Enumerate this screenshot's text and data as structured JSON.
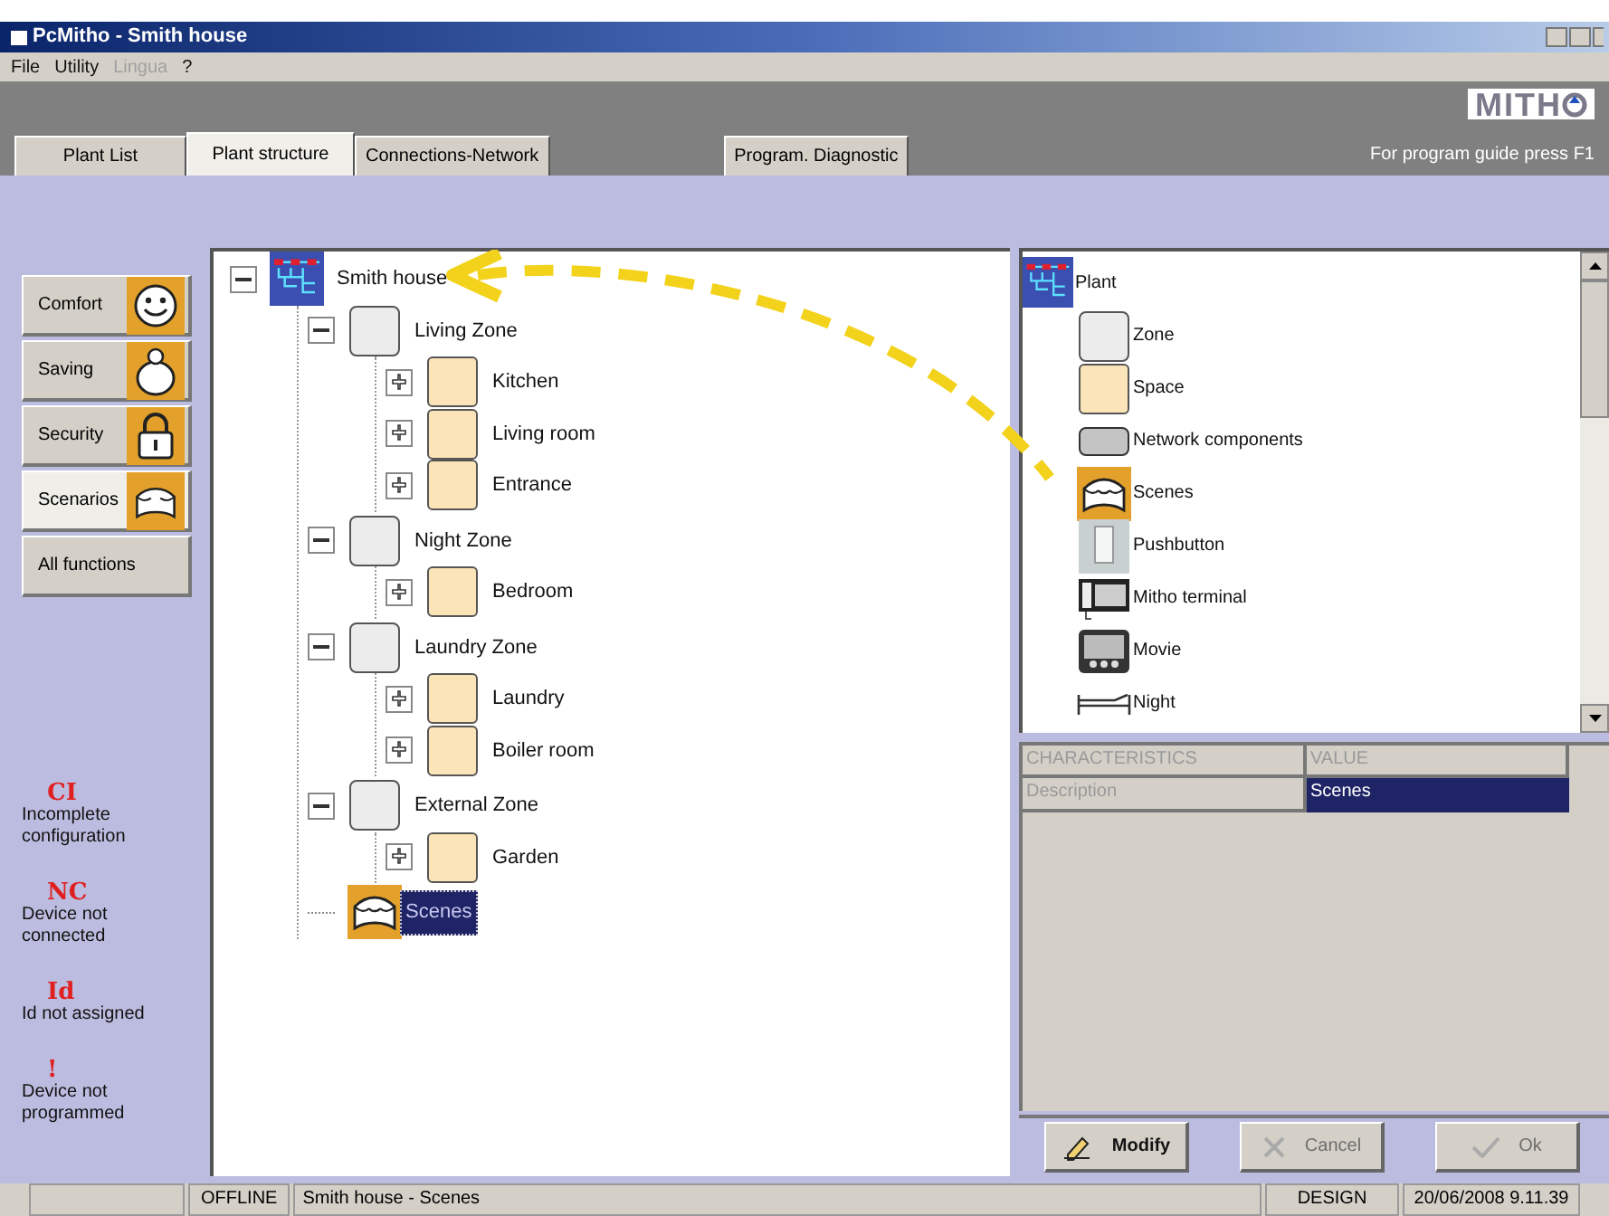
{
  "window": {
    "title": "PcMitho - Smith house"
  },
  "menu": [
    {
      "label": "File",
      "disabled": false
    },
    {
      "label": "Utility",
      "disabled": false
    },
    {
      "label": "Lingua",
      "disabled": true
    },
    {
      "label": "?",
      "disabled": false
    }
  ],
  "tabs": [
    {
      "label": "Plant List",
      "selected": false
    },
    {
      "label": "Plant structure",
      "selected": true
    },
    {
      "label": "Connections-Network",
      "selected": false
    },
    {
      "label": "Program. Diagnostic",
      "selected": false
    }
  ],
  "logo": "MITH",
  "help_hint": "For program guide press F1",
  "functions": [
    {
      "label": "Comfort",
      "kind": "smile",
      "selected": false
    },
    {
      "label": "Saving",
      "kind": "piggy",
      "selected": false
    },
    {
      "label": "Security",
      "kind": "lock",
      "selected": false
    },
    {
      "label": "Scenarios",
      "kind": "scenes",
      "selected": true
    },
    {
      "label": "All functions",
      "kind": "plain",
      "selected": false
    }
  ],
  "legend": [
    {
      "code": "CI",
      "text": "Incomplete configuration"
    },
    {
      "code": "NC",
      "text": "Device not connected"
    },
    {
      "code": "Id",
      "text": "Id not assigned"
    },
    {
      "code": "!",
      "text": "Device not programmed"
    }
  ],
  "tree": [
    {
      "label": "Smith house",
      "kind": "plant",
      "expanded": true,
      "selected": false,
      "children": [
        {
          "label": "Living Zone",
          "kind": "zone",
          "expanded": true,
          "selected": false,
          "children": [
            {
              "label": "Kitchen",
              "kind": "space",
              "expanded": false,
              "selected": false
            },
            {
              "label": "Living room",
              "kind": "space",
              "expanded": false,
              "selected": false
            },
            {
              "label": "Entrance",
              "kind": "space",
              "expanded": false,
              "selected": false
            }
          ]
        },
        {
          "label": "Night Zone",
          "kind": "zone",
          "expanded": true,
          "selected": false,
          "children": [
            {
              "label": "Bedroom",
              "kind": "space",
              "expanded": false,
              "selected": false
            }
          ]
        },
        {
          "label": "Laundry Zone",
          "kind": "zone",
          "expanded": true,
          "selected": false,
          "children": [
            {
              "label": "Laundry",
              "kind": "space",
              "expanded": false,
              "selected": false
            },
            {
              "label": "Boiler room",
              "kind": "space",
              "expanded": false,
              "selected": false
            }
          ]
        },
        {
          "label": "External Zone",
          "kind": "zone",
          "expanded": true,
          "selected": false,
          "children": [
            {
              "label": "Garden",
              "kind": "space",
              "expanded": false,
              "selected": false
            }
          ]
        },
        {
          "label": "Scenes",
          "kind": "scenes",
          "selected": true
        }
      ]
    }
  ],
  "palette": [
    {
      "label": "Plant",
      "kind": "plant"
    },
    {
      "label": "Zone",
      "kind": "zone"
    },
    {
      "label": "Space",
      "kind": "space"
    },
    {
      "label": "Network components",
      "kind": "network"
    },
    {
      "label": "Scenes",
      "kind": "scenes"
    },
    {
      "label": "Pushbutton",
      "kind": "pushbutton"
    },
    {
      "label": "Mitho terminal",
      "kind": "terminal"
    },
    {
      "label": "Movie",
      "kind": "movie"
    },
    {
      "label": "Night",
      "kind": "night"
    }
  ],
  "properties": {
    "columns": [
      "CHARACTERISTICS",
      "VALUE"
    ],
    "rows": [
      {
        "name": "Description",
        "value": "Scenes",
        "selected": true
      }
    ]
  },
  "buttons": [
    {
      "label": "Modify",
      "kind": "modify",
      "disabled": false
    },
    {
      "label": "Cancel",
      "kind": "cancel",
      "disabled": true
    },
    {
      "label": "Ok",
      "kind": "ok",
      "disabled": true
    }
  ],
  "status_bar": {
    "mode": "OFFLINE",
    "path": "Smith house - Scenes",
    "view": "DESIGN",
    "datetime": "20/06/2008 9.11.39"
  }
}
